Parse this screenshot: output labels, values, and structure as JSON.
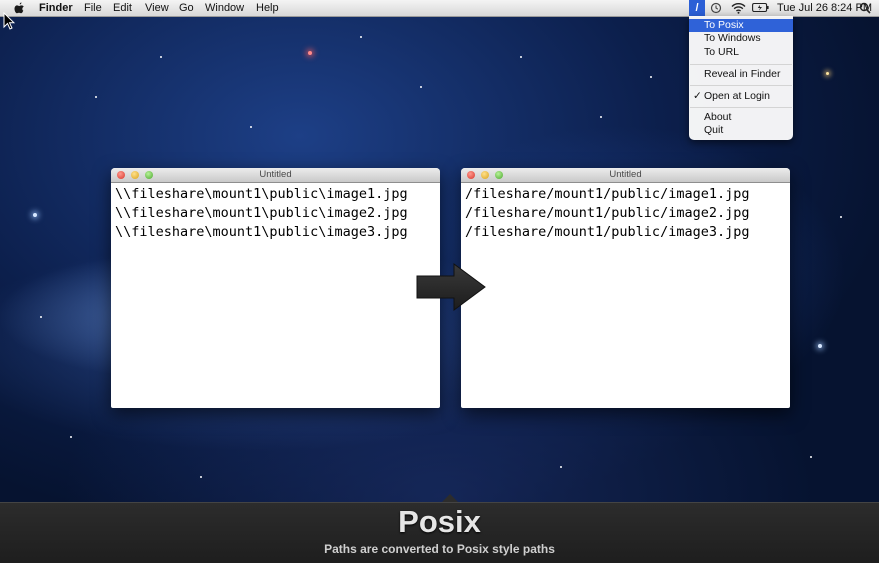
{
  "menubar": {
    "app_name": "Finder",
    "menus": [
      "File",
      "Edit",
      "View",
      "Go",
      "Window",
      "Help"
    ],
    "status_item_glyph": "/",
    "clock": "Tue Jul 26  8:24 PM",
    "icons": [
      "apple-icon",
      "time-machine-icon",
      "wifi-icon",
      "battery-icon",
      "spotlight-icon"
    ]
  },
  "dropdown": {
    "items": [
      {
        "label": "To Posix",
        "highlighted": true
      },
      {
        "label": "To Windows"
      },
      {
        "label": "To URL"
      },
      {
        "label": "Reveal in Finder"
      },
      {
        "label": "Open at Login",
        "checked": true,
        "check_mark": "✓"
      },
      {
        "label": "About"
      },
      {
        "label": "Quit"
      }
    ]
  },
  "windows": {
    "left": {
      "title": "Untitled",
      "lines": [
        "\\\\fileshare\\mount1\\public\\image1.jpg",
        "\\\\fileshare\\mount1\\public\\image2.jpg",
        "\\\\fileshare\\mount1\\public\\image3.jpg"
      ]
    },
    "right": {
      "title": "Untitled",
      "lines": [
        "/fileshare/mount1/public/image1.jpg",
        "/fileshare/mount1/public/image2.jpg",
        "/fileshare/mount1/public/image3.jpg"
      ]
    }
  },
  "caption": {
    "title": "Posix",
    "subtitle": "Paths are converted to Posix style paths"
  },
  "colors": {
    "menu_highlight": "#2f62d8",
    "caption_bg": "#242424"
  }
}
